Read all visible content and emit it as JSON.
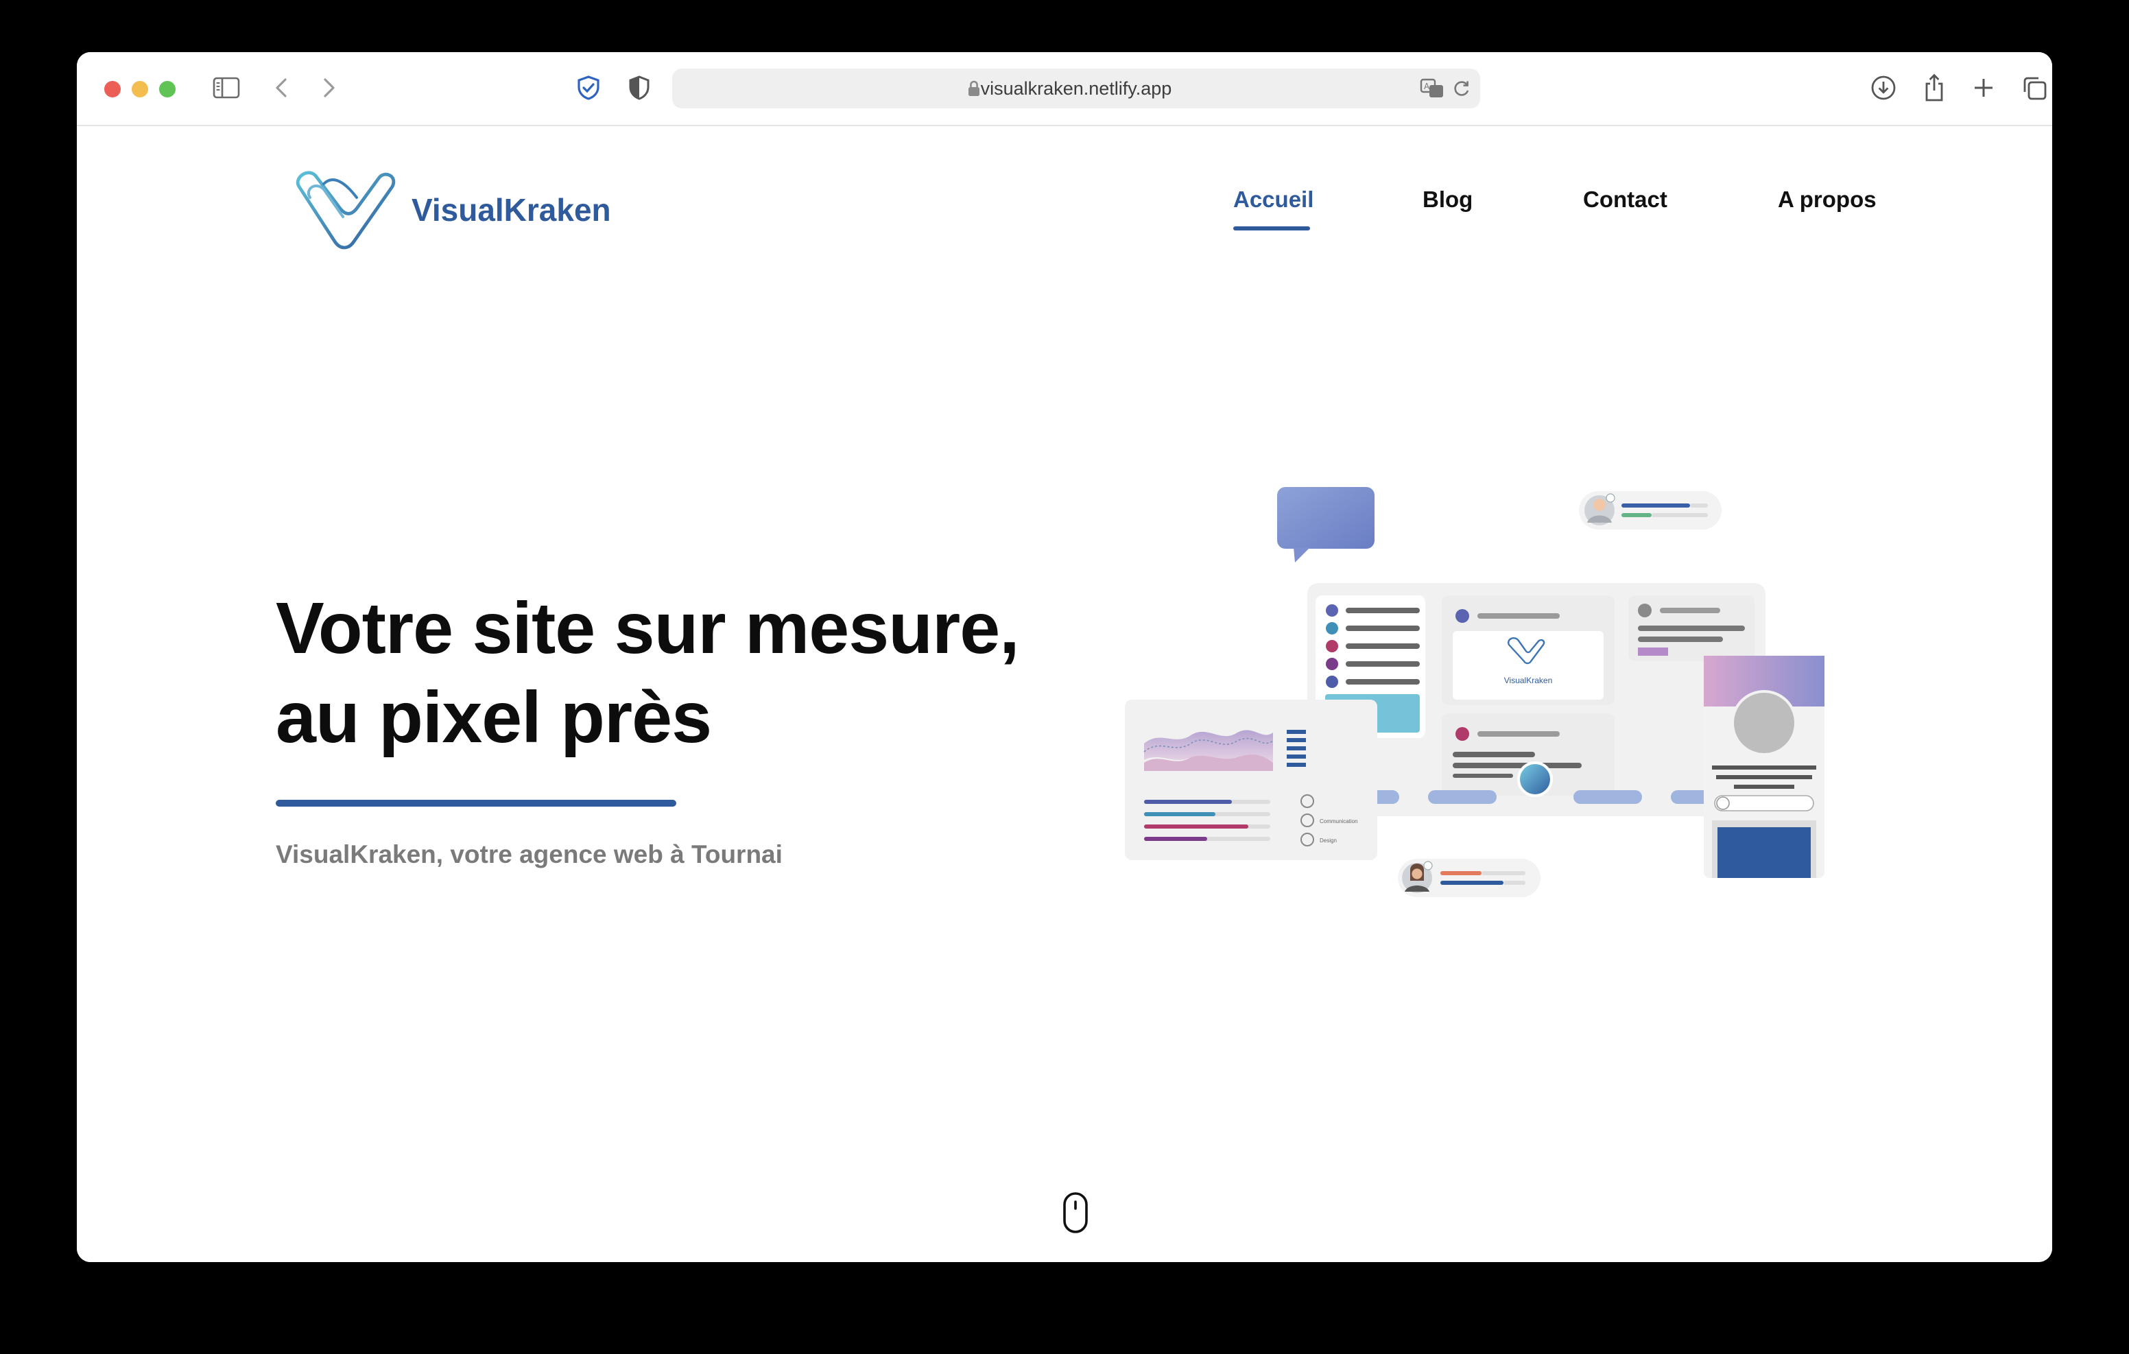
{
  "browser": {
    "url": "visualkraken.netlify.app",
    "traffic_lights": {
      "close": "#ec5f57",
      "minimize": "#f4bd4f",
      "zoom": "#5fc455"
    }
  },
  "site": {
    "brand": "VisualKraken",
    "brand_color": "#2f5a9c",
    "nav": {
      "home": "Accueil",
      "blog": "Blog",
      "contact": "Contact",
      "about": "A propos"
    },
    "hero": {
      "title_line1": "Votre site sur mesure,",
      "title_line2": "au pixel près",
      "subtitle": "VisualKraken, votre agence web à Tournai"
    },
    "illustration": {
      "logo_label": "VisualKraken",
      "legend_1": "Communication",
      "legend_2": "Design"
    }
  }
}
